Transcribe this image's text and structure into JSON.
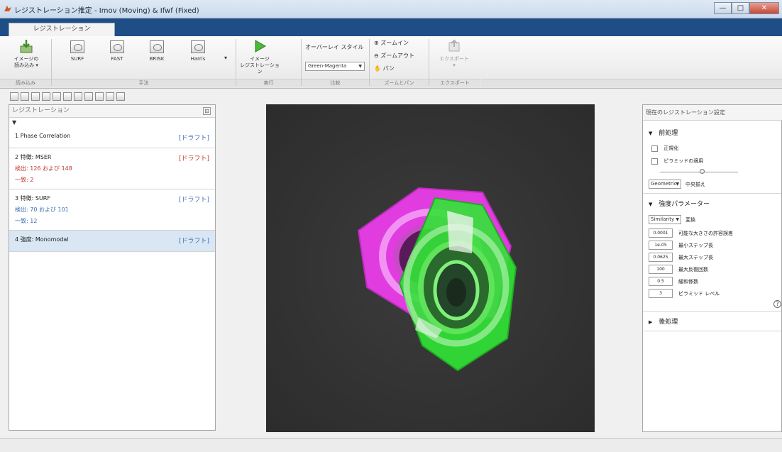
{
  "window": {
    "title": "レジストレーション推定 - Imov (Moving) & Ifwf (Fixed)",
    "controls": {
      "minimize": "—",
      "maximize": "□",
      "close": "✕"
    }
  },
  "tabs": [
    {
      "label": "レジストレーション"
    }
  ],
  "ribbon": {
    "load_button": {
      "line1": "イメージの",
      "line2": "読み込み ▾"
    },
    "features": [
      "SURF",
      "FAST",
      "BRISK",
      "Harris"
    ],
    "register_button": {
      "line1": "イメージ",
      "line2": "レジストレーション"
    },
    "overlay_style": {
      "label": "オーバーレイ スタイル",
      "value": "Green-Magenta"
    },
    "zoom_in": "ズームイン",
    "zoom_out": "ズームアウト",
    "pan": "パン",
    "export": "エクスポート",
    "group_footers": [
      "読み込み",
      "手法",
      "実行",
      "比較",
      "ズームとパン",
      "エクスポート"
    ]
  },
  "left_panel": {
    "header": "レジストレーション",
    "steps": [
      {
        "name": "1  Phase Correlation",
        "draft": "[ドラフト]",
        "draft_color": "#3a6fb5",
        "lines": []
      },
      {
        "name": "2  特徴: MSER",
        "draft": "[ドラフト]",
        "draft_color": "#c0392b",
        "lines": [
          "検出: 126 および 148",
          "一致: 2"
        ],
        "lines_color": "#c0392b"
      },
      {
        "name": "3  特徴: SURF",
        "draft": "[ドラフト]",
        "draft_color": "#3a6fb5",
        "lines": [
          "検出: 70 および 101",
          "一致: 12"
        ],
        "lines_color": "#3a6fb5"
      },
      {
        "name": "4  強度: Monomodal",
        "draft": "[ドラフト]",
        "draft_color": "#3a6fb5",
        "lines": [],
        "selected": true
      }
    ]
  },
  "right_panel": {
    "title": "現在のレジストレーション設定",
    "preprocess": {
      "label": "前処理",
      "checkbox1": "正規化",
      "checkbox2": "ピラミッドの適用"
    },
    "transform_dropdown": {
      "value": "Geometric",
      "label": "中央揃え"
    },
    "intensity_params": {
      "label": "強度パラメーター",
      "transform": {
        "value": "Similarity",
        "label": "変換"
      },
      "params": [
        {
          "value": "0.0001",
          "label": "可能な大きさの許容誤差"
        },
        {
          "value": "1e-05",
          "label": "最小ステップ長"
        },
        {
          "value": "0.0625",
          "label": "最大ステップ長"
        },
        {
          "value": "100",
          "label": "最大反復回数"
        },
        {
          "value": "0.5",
          "label": "緩和係数"
        },
        {
          "value": "3",
          "label": "ピラミッド レベル"
        }
      ]
    },
    "postprocess": {
      "label": "後処理"
    },
    "help": "?"
  },
  "colors": {
    "magenta": "#e03ce0",
    "green": "#31e635",
    "background": "#343434",
    "tab_strip": "#1f4e86"
  }
}
